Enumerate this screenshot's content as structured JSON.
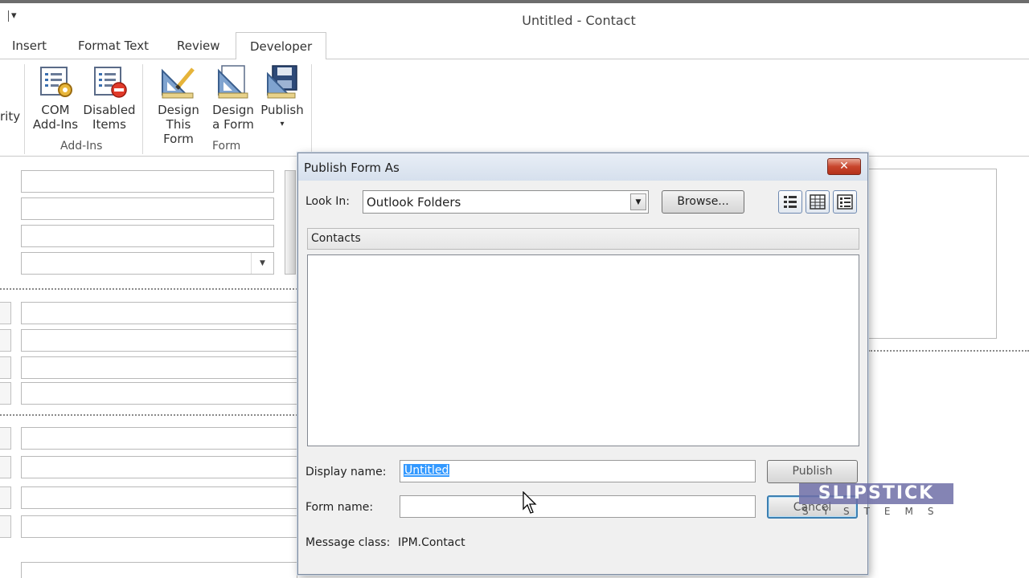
{
  "window": {
    "title": "Untitled  -  Contact",
    "qat_arrow": "▾"
  },
  "tabs": [
    {
      "label": "Insert"
    },
    {
      "label": "Format Text"
    },
    {
      "label": "Review"
    },
    {
      "label": "Developer",
      "active": true
    }
  ],
  "ribbon": {
    "partial_label": "rity",
    "buttons": [
      {
        "line1": "COM",
        "line2": "Add-Ins",
        "icon": "com-addins-icon"
      },
      {
        "line1": "Disabled",
        "line2": "Items",
        "icon": "disabled-items-icon"
      },
      {
        "line1": "Design",
        "line2": "This Form",
        "icon": "design-this-form-icon"
      },
      {
        "line1": "Design",
        "line2": "a Form",
        "icon": "design-a-form-icon"
      },
      {
        "line1": "Publish",
        "line2": "▾",
        "icon": "publish-icon"
      }
    ],
    "groups": [
      "Add-Ins",
      "Form"
    ]
  },
  "dialog": {
    "title": "Publish Form As",
    "close_glyph": "✕",
    "look_in_label": "Look In:",
    "look_in_value": "Outlook Folders",
    "browse_label": "Browse...",
    "current_folder": "Contacts",
    "display_name_label": "Display name:",
    "display_name_value": "Untitled",
    "form_name_label": "Form name:",
    "form_name_value": "",
    "message_class_label": "Message class:",
    "message_class_value": "IPM.Contact",
    "publish_label": "Publish",
    "cancel_label": "Cancel"
  },
  "watermark": {
    "top": "SLIPSTICK",
    "bottom": "SYSTEMS"
  },
  "colors": {
    "selection": "#3399ff",
    "close_button": "#c8452c",
    "dialog_bg": "#f0f0f0"
  }
}
